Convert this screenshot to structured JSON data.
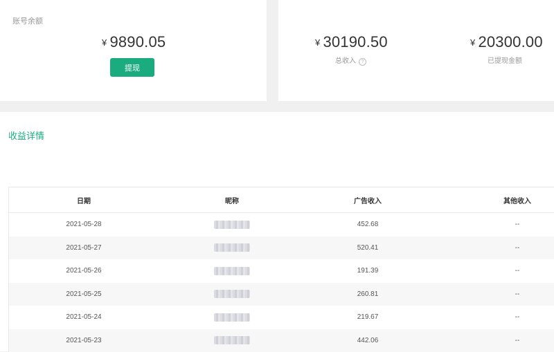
{
  "summary": {
    "balance_label": "账号余额",
    "currency_symbol": "¥",
    "balance": "9890.05",
    "withdraw_button": "提现",
    "total_income": "30190.50",
    "total_income_label": "总收入",
    "total_income_help": "?",
    "withdrawn": "20300.00",
    "withdrawn_label": "已提现金额"
  },
  "details": {
    "title": "收益详情",
    "columns": [
      "日期",
      "昵称",
      "广告收入",
      "其他收入"
    ],
    "rows": [
      {
        "date": "2021-05-28",
        "ad_income": "452.68",
        "other_income": "--"
      },
      {
        "date": "2021-05-27",
        "ad_income": "520.41",
        "other_income": "--"
      },
      {
        "date": "2021-05-26",
        "ad_income": "191.39",
        "other_income": "--"
      },
      {
        "date": "2021-05-25",
        "ad_income": "260.81",
        "other_income": "--"
      },
      {
        "date": "2021-05-24",
        "ad_income": "219.67",
        "other_income": "--"
      },
      {
        "date": "2021-05-23",
        "ad_income": "442.06",
        "other_income": "--"
      }
    ]
  },
  "colors": {
    "accent": "#1aab7e",
    "background": "#f0f0f0",
    "row_alt": "#f7f7f7"
  }
}
